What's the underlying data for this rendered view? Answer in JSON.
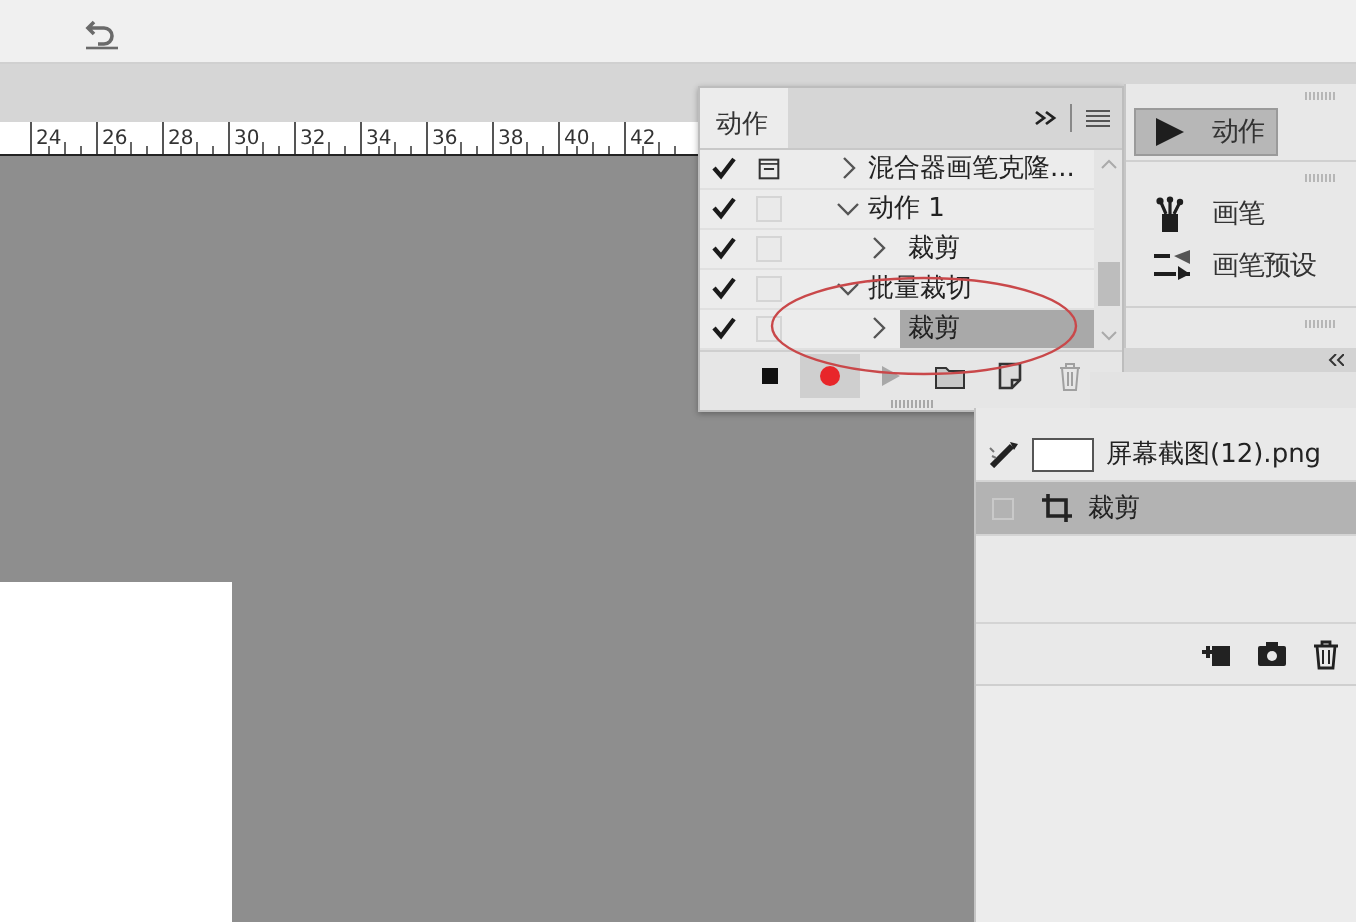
{
  "ruler": {
    "labels": [
      "24",
      "26",
      "28",
      "30",
      "32",
      "34",
      "36",
      "38",
      "40",
      "42"
    ]
  },
  "actions_panel": {
    "tab": {
      "label": "动作",
      "selected": true
    },
    "items": [
      {
        "name": "混合器画笔克隆...",
        "checked": true,
        "dialog": true,
        "expanded": false,
        "selected": false
      },
      {
        "name": "动作 1",
        "checked": true,
        "dialog": false,
        "expanded": true,
        "selected": false,
        "children": [
          {
            "name": "裁剪",
            "checked": true,
            "dialog": false,
            "expanded": false,
            "selected": false
          }
        ]
      },
      {
        "name": "批量裁切",
        "checked": true,
        "dialog": false,
        "expanded": true,
        "selected": false,
        "children": [
          {
            "name": "裁剪",
            "checked": true,
            "dialog": false,
            "expanded": false,
            "selected": true
          }
        ]
      }
    ],
    "recording": true
  },
  "dock": {
    "items": [
      {
        "label": "动作",
        "kind": "actions",
        "selected": true
      },
      {
        "label": "画笔",
        "kind": "brush",
        "selected": false
      },
      {
        "label": "画笔预设",
        "kind": "brush-preset",
        "selected": false
      }
    ]
  },
  "history": {
    "source": {
      "name": "屏幕截图(12).png"
    },
    "states": [
      {
        "label": "裁剪",
        "selected": true
      }
    ]
  }
}
